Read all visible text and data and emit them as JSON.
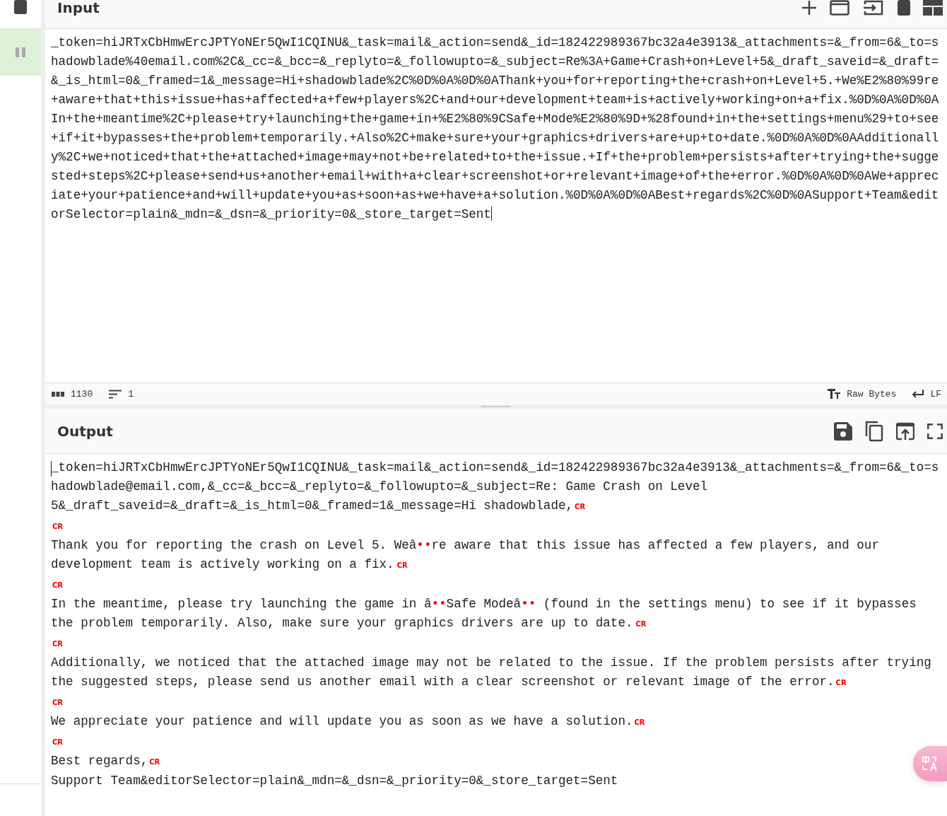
{
  "sidebar": {
    "buttons": [
      {
        "kind": "stop",
        "highlighted": false
      },
      {
        "kind": "pause",
        "highlighted": true
      }
    ]
  },
  "input": {
    "title": "Input",
    "value": "_token=hiJRTxCbHmwErcJPTYoNEr5QwI1CQINU&_task=mail&_action=send&_id=182422989367bc32a4e3913&_attachments=&_from=6&_to=shadowblade%40email.com%2C&_cc=&_bcc=&_replyto=&_followupto=&_subject=Re%3A+Game+Crash+on+Level+5&_draft_saveid=&_draft=&_is_html=0&_framed=1&_message=Hi+shadowblade%2C%0D%0A%0D%0AThank+you+for+reporting+the+crash+on+Level+5.+We%E2%80%99re+aware+that+this+issue+has+affected+a+few+players%2C+and+our+development+team+is+actively+working+on+a+fix.%0D%0A%0D%0AIn+the+meantime%2C+please+try+launching+the+game+in+%E2%80%9CSafe+Mode%E2%80%9D+%28found+in+the+settings+menu%29+to+see+if+it+bypasses+the+problem+temporarily.+Also%2C+make+sure+your+graphics+drivers+are+up+to+date.%0D%0A%0D%0AAdditionally%2C+we+noticed+that+the+attached+image+may+not+be+related+to+the+issue.+If+the+problem+persists+after+trying+the+suggested+steps%2C+please+send+us+another+email+with+a+clear+screenshot+or+relevant+image+of+the+error.%0D%0A%0D%0AWe+appreciate+your+patience+and+will+update+you+as+soon+as+we+have+a+solution.%0D%0A%0D%0ABest+regards%2C%0D%0ASupport+Team&editorSelector=plain&_mdn=&_dsn=&_priority=0&_store_target=Sent",
    "status": {
      "length": "1130",
      "lines": "1",
      "encoding": "Raw Bytes",
      "eol": "LF"
    }
  },
  "output": {
    "title": "Output",
    "lines": [
      {
        "segments": [
          {
            "kind": "text",
            "text": "_token=hiJRTxCbHmwErcJPTYoNEr5QwI1CQINU&_task=mail&_action=send&_id=182422989367bc32a4e3913&_attachments=&_from=6&_to=shadowblade@email.com,&_cc=&_bcc=&_replyto=&_followupto=&_subject=Re: Game Crash on Level 5&_draft_saveid=&_draft=&_is_html=0&_framed=1&_message=Hi shadowblade,"
          }
        ],
        "end": "CR"
      },
      {
        "end": "CR"
      },
      {
        "segments": [
          {
            "kind": "text",
            "text": "Thank you for reporting the crash on Level 5. Weâ"
          },
          {
            "kind": "control",
            "text": "••"
          },
          {
            "kind": "text",
            "text": "re aware that this issue has affected a few players, and our development team is actively working on a fix."
          }
        ],
        "end": "CR"
      },
      {
        "end": "CR"
      },
      {
        "segments": [
          {
            "kind": "text",
            "text": "In the meantime, please try launching the game in â"
          },
          {
            "kind": "control",
            "text": "••"
          },
          {
            "kind": "text",
            "text": "Safe Modeâ"
          },
          {
            "kind": "control",
            "text": "••"
          },
          {
            "kind": "text",
            "text": " (found in the settings menu) to see if it bypasses the problem temporarily. Also, make sure your graphics drivers are up to date."
          }
        ],
        "end": "CR"
      },
      {
        "end": "CR"
      },
      {
        "segments": [
          {
            "kind": "text",
            "text": "Additionally, we noticed that the attached image may not be related to the issue. If the problem persists after trying the suggested steps, please send us another email with a clear screenshot or relevant image of the error."
          }
        ],
        "end": "CR"
      },
      {
        "end": "CR"
      },
      {
        "segments": [
          {
            "kind": "text",
            "text": "We appreciate your patience and will update you as soon as we have a solution."
          }
        ],
        "end": "CR"
      },
      {
        "end": "CR"
      },
      {
        "segments": [
          {
            "kind": "text",
            "text": "Best regards,"
          }
        ],
        "end": "CR"
      },
      {
        "segments": [
          {
            "kind": "text",
            "text": "Support Team&editorSelector=plain&_mdn=&_dsn=&_priority=0&_store_target=Sent"
          }
        ]
      }
    ]
  }
}
